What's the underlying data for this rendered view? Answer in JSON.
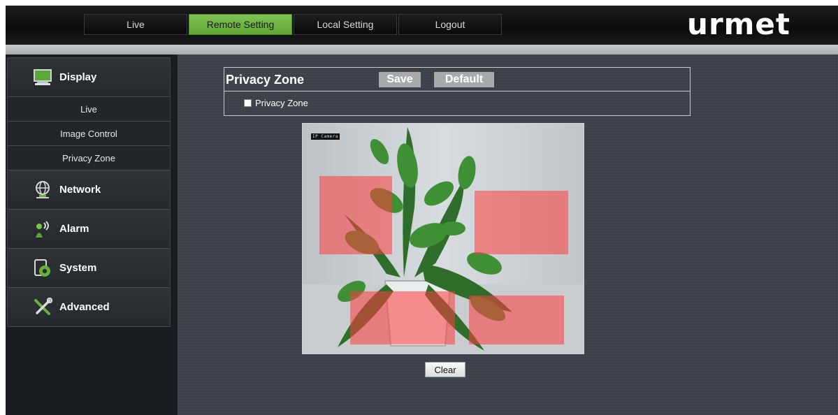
{
  "header": {
    "tabs": [
      {
        "label": "Live",
        "active": false
      },
      {
        "label": "Remote Setting",
        "active": true
      },
      {
        "label": "Local Setting",
        "active": false
      },
      {
        "label": "Logout",
        "active": false
      }
    ],
    "logo_text": "urmet"
  },
  "sidebar": {
    "items": [
      {
        "label": "Display",
        "icon": "monitor-icon"
      },
      {
        "label": "Network",
        "icon": "network-globe-icon"
      },
      {
        "label": "Alarm",
        "icon": "alarm-icon"
      },
      {
        "label": "System",
        "icon": "system-gear-icon"
      },
      {
        "label": "Advanced",
        "icon": "wrench-screwdriver-icon"
      }
    ],
    "display_subitems": [
      "Live",
      "Image Control",
      "Privacy Zone"
    ]
  },
  "panel": {
    "title": "Privacy Zone",
    "save_label": "Save",
    "default_label": "Default",
    "checkbox_label": "Privacy Zone",
    "checkbox_checked": false
  },
  "camera": {
    "osd_label": "IP Camera",
    "privacy_zone_count": 4
  },
  "clear_label": "Clear",
  "colors": {
    "active_tab": "#6db03f",
    "privacy_zone": "#e85050",
    "accent_gray": "#a9a9a9"
  }
}
